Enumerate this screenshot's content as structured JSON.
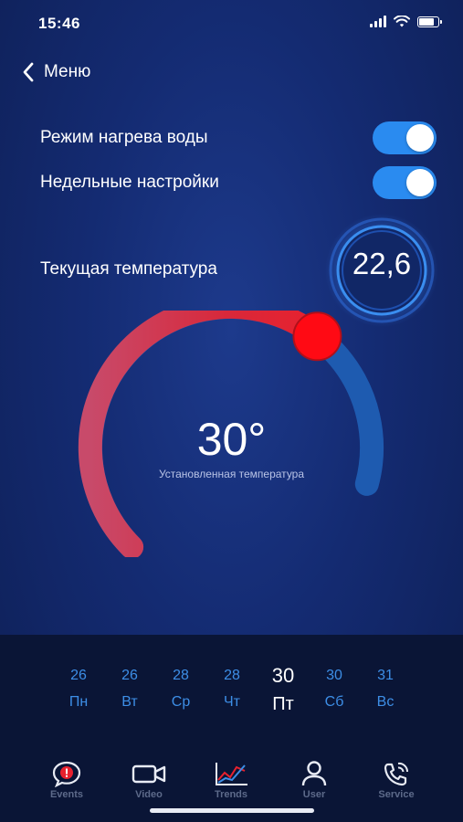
{
  "status_bar": {
    "time": "15:46"
  },
  "header": {
    "back_label": "Меню"
  },
  "settings": [
    {
      "label": "Режим нагрева воды",
      "enabled": true
    },
    {
      "label": "Недельные настройки",
      "enabled": true
    }
  ],
  "current_temperature": {
    "label": "Текущая температура",
    "value": "22,6"
  },
  "set_temperature": {
    "value": "30°",
    "caption": "Установленная температура",
    "level_fraction": 0.72
  },
  "week": [
    {
      "date": "26",
      "day": "Пн",
      "active": false
    },
    {
      "date": "26",
      "day": "Вт",
      "active": false
    },
    {
      "date": "28",
      "day": "Ср",
      "active": false
    },
    {
      "date": "28",
      "day": "Чт",
      "active": false
    },
    {
      "date": "30",
      "day": "Пт",
      "active": true
    },
    {
      "date": "30",
      "day": "Сб",
      "active": false
    },
    {
      "date": "31",
      "day": "Вс",
      "active": false
    }
  ],
  "tabs": [
    {
      "label": "Events",
      "icon": "alert-bubble-icon"
    },
    {
      "label": "Video",
      "icon": "video-camera-icon"
    },
    {
      "label": "Trends",
      "icon": "trend-chart-icon"
    },
    {
      "label": "User",
      "icon": "user-icon"
    },
    {
      "label": "Service",
      "icon": "phone-service-icon"
    }
  ],
  "colors": {
    "accent": "#2a8bf0",
    "heat": "#e8212e",
    "cold": "#1e5bb0",
    "day_inactive": "#3d8ee6"
  }
}
